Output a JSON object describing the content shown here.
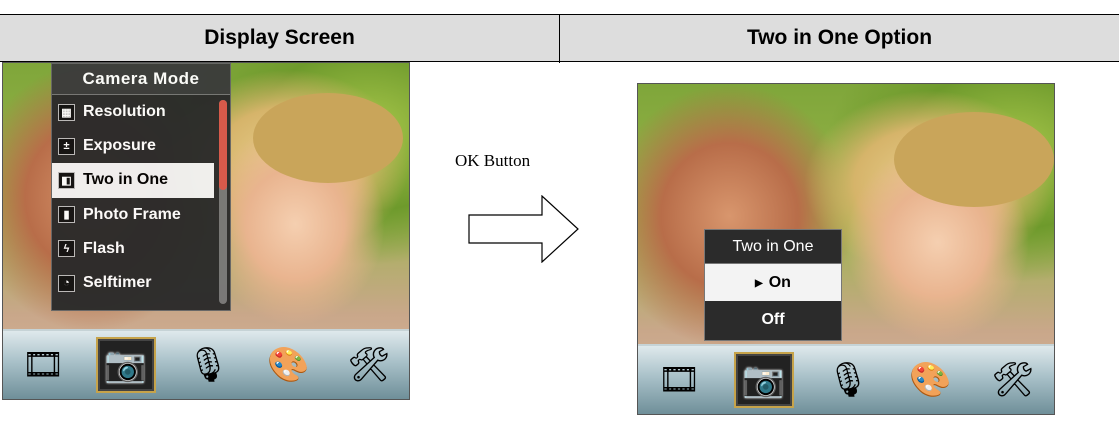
{
  "header": {
    "left_title": "Display Screen",
    "right_title": "Two in One Option"
  },
  "left_screen": {
    "menu_title": "Camera Mode",
    "menu_items": [
      {
        "label": "Resolution",
        "icon": "resolution-icon",
        "glyph": "▦"
      },
      {
        "label": "Exposure",
        "icon": "exposure-icon",
        "glyph": "±"
      },
      {
        "label": "Two in One",
        "icon": "two-in-one-icon",
        "glyph": "◧",
        "selected": true
      },
      {
        "label": "Photo Frame",
        "icon": "photo-frame-icon",
        "glyph": "▮"
      },
      {
        "label": "Flash",
        "icon": "flash-icon",
        "glyph": "ϟ"
      },
      {
        "label": "Selftimer",
        "icon": "selftimer-icon",
        "glyph": "◔"
      }
    ]
  },
  "toolbar_icons": [
    {
      "name": "video-mode-icon",
      "glyph": "🎞"
    },
    {
      "name": "camera-mode-icon",
      "glyph": "📷",
      "selected": true
    },
    {
      "name": "voice-record-icon",
      "glyph": "🎙"
    },
    {
      "name": "effects-palette-icon",
      "glyph": "🎨"
    },
    {
      "name": "settings-tools-icon",
      "glyph": "🛠"
    }
  ],
  "transition": {
    "label": "OK Button"
  },
  "right_screen": {
    "popup_title": "Two in One",
    "options": [
      {
        "label": "On",
        "selected": true
      },
      {
        "label": "Off",
        "selected": false
      }
    ]
  },
  "colors": {
    "header_bg": "#dddddd",
    "highlight": "#f2f2f2",
    "menu_bg": "#2a2a2a",
    "scroll_thumb": "#d9574a"
  }
}
